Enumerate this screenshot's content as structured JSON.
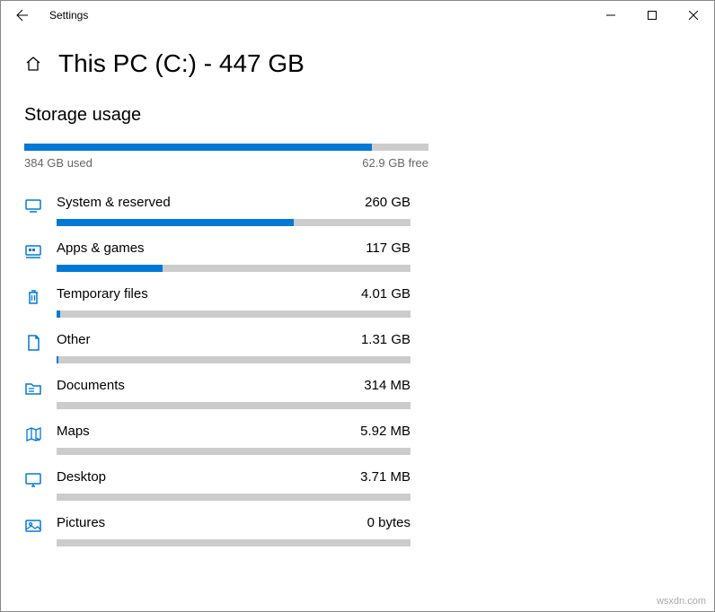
{
  "window": {
    "app_title": "Settings"
  },
  "page": {
    "title": "This PC (C:) - 447 GB",
    "section_title": "Storage usage"
  },
  "overall": {
    "used_label": "384 GB used",
    "free_label": "62.9 GB free",
    "fill_percent": 86
  },
  "categories": [
    {
      "id": "system",
      "label": "System & reserved",
      "size": "260 GB",
      "fill_percent": 67
    },
    {
      "id": "apps",
      "label": "Apps & games",
      "size": "117 GB",
      "fill_percent": 30
    },
    {
      "id": "temp",
      "label": "Temporary files",
      "size": "4.01 GB",
      "fill_percent": 1
    },
    {
      "id": "other",
      "label": "Other",
      "size": "1.31 GB",
      "fill_percent": 0.5
    },
    {
      "id": "documents",
      "label": "Documents",
      "size": "314 MB",
      "fill_percent": 0
    },
    {
      "id": "maps",
      "label": "Maps",
      "size": "5.92 MB",
      "fill_percent": 0
    },
    {
      "id": "desktop",
      "label": "Desktop",
      "size": "3.71 MB",
      "fill_percent": 0
    },
    {
      "id": "pictures",
      "label": "Pictures",
      "size": "0 bytes",
      "fill_percent": 0
    }
  ],
  "watermark": "wsxdn.com",
  "chart_data": {
    "type": "bar",
    "title": "Storage usage",
    "drive": "This PC (C:)",
    "total_gb": 447,
    "used_gb": 384,
    "free_gb": 62.9,
    "series": [
      {
        "name": "System & reserved",
        "value": 260,
        "unit": "GB"
      },
      {
        "name": "Apps & games",
        "value": 117,
        "unit": "GB"
      },
      {
        "name": "Temporary files",
        "value": 4.01,
        "unit": "GB"
      },
      {
        "name": "Other",
        "value": 1.31,
        "unit": "GB"
      },
      {
        "name": "Documents",
        "value": 314,
        "unit": "MB"
      },
      {
        "name": "Maps",
        "value": 5.92,
        "unit": "MB"
      },
      {
        "name": "Desktop",
        "value": 3.71,
        "unit": "MB"
      },
      {
        "name": "Pictures",
        "value": 0,
        "unit": "bytes"
      }
    ]
  }
}
